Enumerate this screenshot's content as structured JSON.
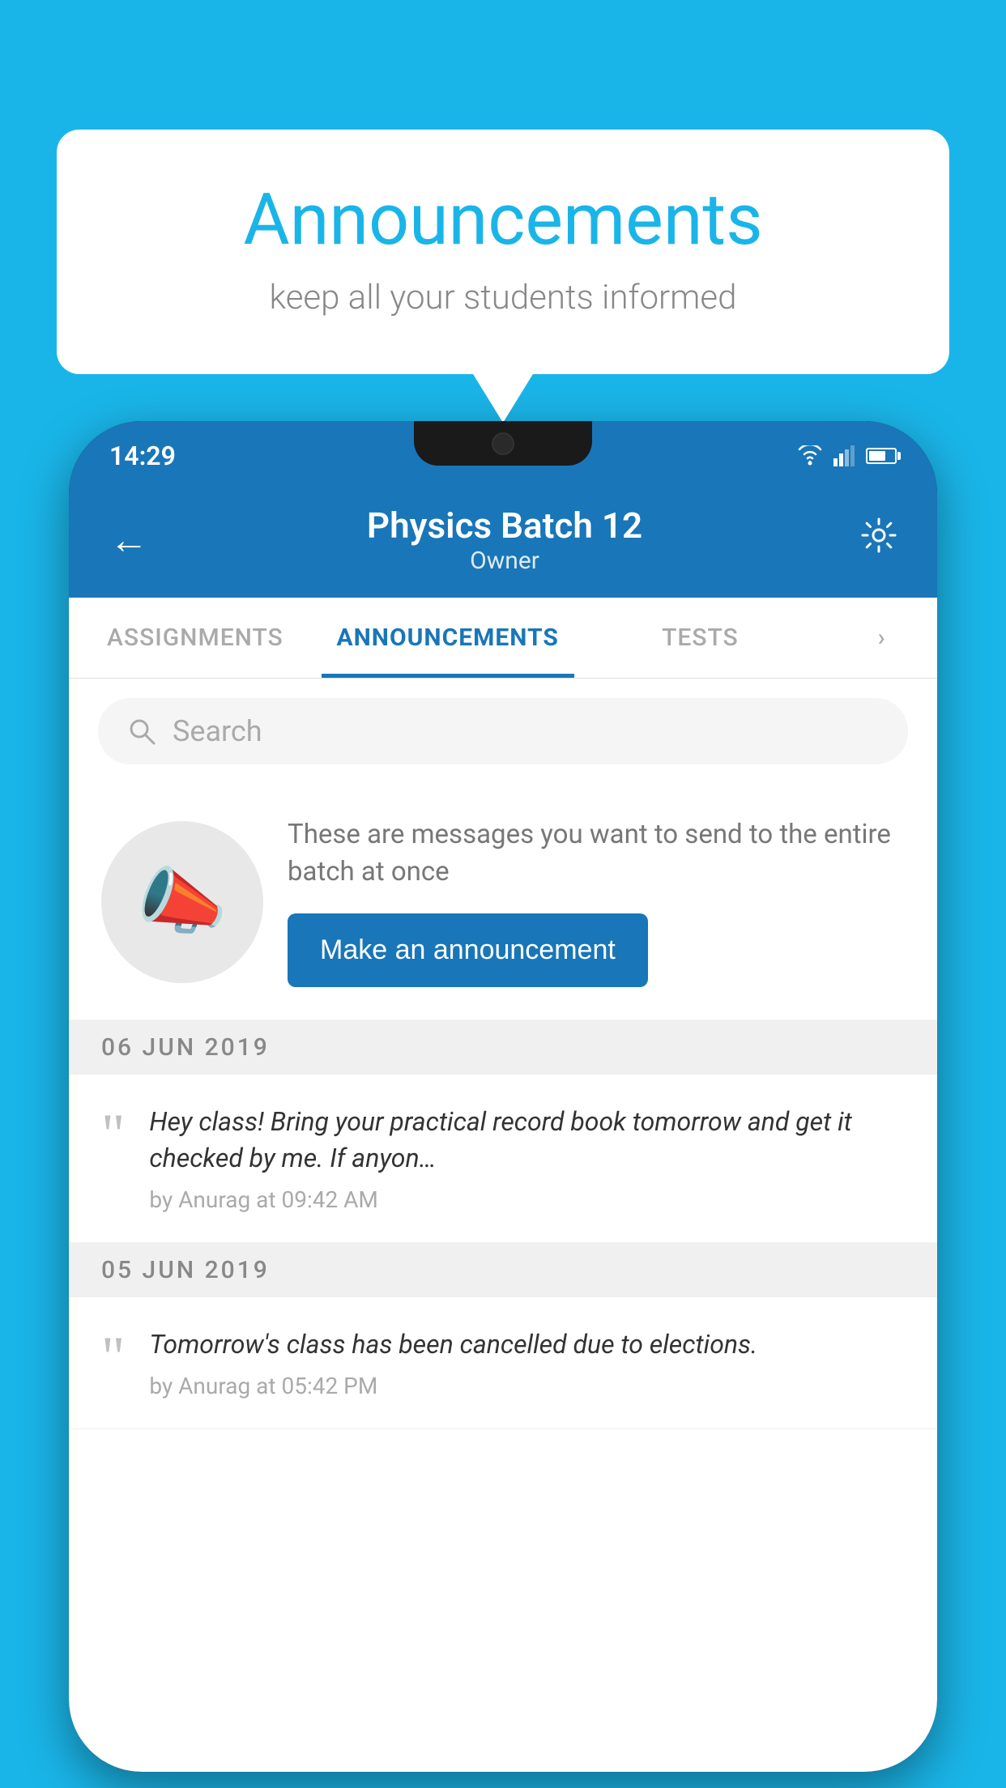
{
  "bubble": {
    "title": "Announcements",
    "subtitle": "keep all your students informed"
  },
  "status_bar": {
    "time": "14:29"
  },
  "header": {
    "title": "Physics Batch 12",
    "subtitle": "Owner",
    "back_label": "←"
  },
  "tabs": [
    {
      "label": "ASSIGNMENTS",
      "active": false
    },
    {
      "label": "ANNOUNCEMENTS",
      "active": true
    },
    {
      "label": "TESTS",
      "active": false
    },
    {
      "label": "…",
      "active": false,
      "partial": true
    }
  ],
  "search": {
    "placeholder": "Search"
  },
  "promo": {
    "description": "These are messages you want to send to the entire batch at once",
    "button_label": "Make an announcement"
  },
  "announcements": [
    {
      "date": "06  JUN  2019",
      "message": "Hey class! Bring your practical record book tomorrow and get it checked by me. If anyon…",
      "meta": "by Anurag at 09:42 AM"
    },
    {
      "date": "05  JUN  2019",
      "message": "Tomorrow's class has been cancelled due to elections.",
      "meta": "by Anurag at 05:42 PM"
    }
  ],
  "colors": {
    "brand_blue": "#1ab5e8",
    "header_blue": "#1976b8",
    "light_gray": "#f0f0f0"
  }
}
